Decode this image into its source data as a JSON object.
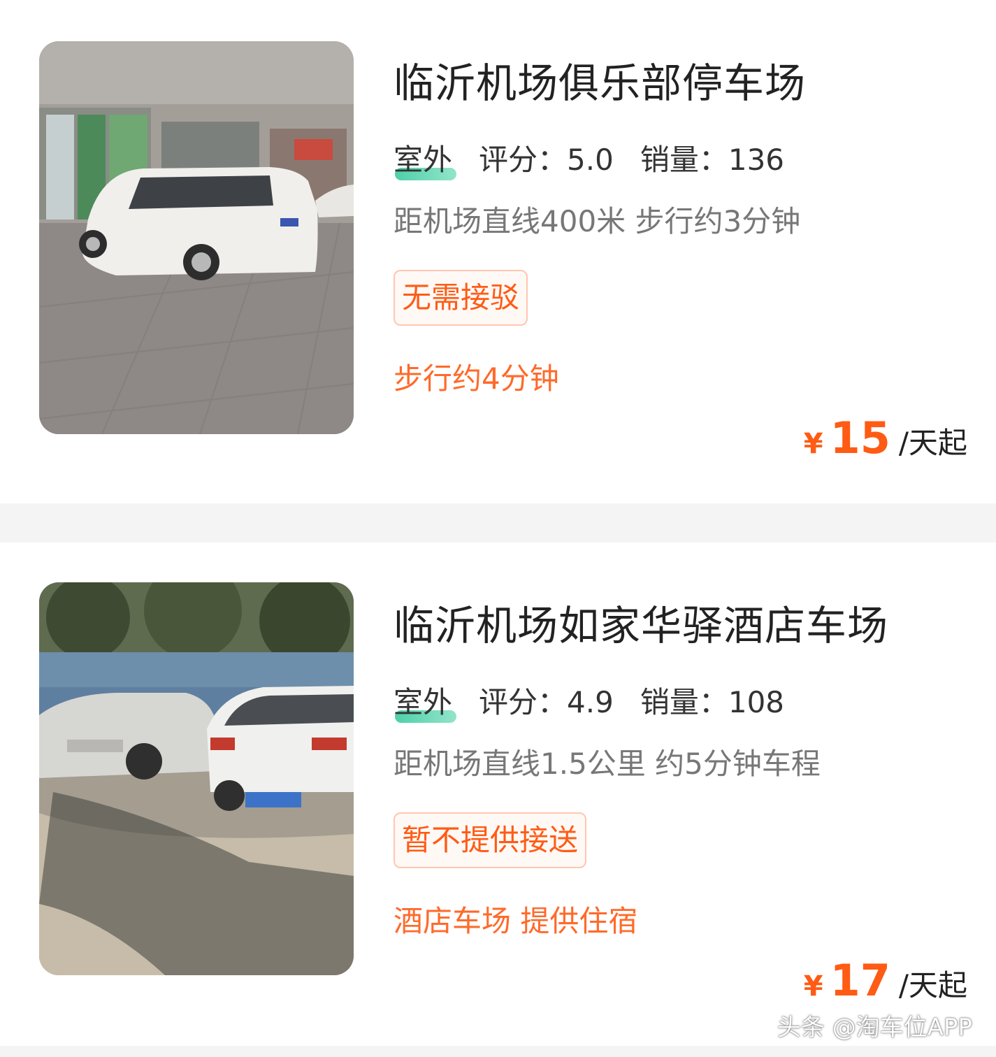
{
  "listings": [
    {
      "title": "临沂机场俱乐部停车场",
      "env_tag": "室外",
      "rating_label": "评分：",
      "rating": "5.0",
      "sales_label": "销量：",
      "sales": "136",
      "distance": "距机场直线400米 步行约3分钟",
      "badge": "无需接驳",
      "note": "步行约4分钟",
      "price_currency": "¥",
      "price_amount": "15",
      "price_unit": "/天起"
    },
    {
      "title": "临沂机场如家华驿酒店车场",
      "env_tag": "室外",
      "rating_label": "评分：",
      "rating": "4.9",
      "sales_label": "销量：",
      "sales": "108",
      "distance": "距机场直线1.5公里 约5分钟车程",
      "badge": "暂不提供接送",
      "note": "酒店车场 提供住宿",
      "price_currency": "¥",
      "price_amount": "17",
      "price_unit": "/天起"
    }
  ],
  "watermark": "头条 @淘车位APP",
  "colors": {
    "accent": "#ff5b14",
    "env_highlight": "#2fc79a",
    "badge_border": "#ffc6b0",
    "divider": "#f4f4f4"
  }
}
